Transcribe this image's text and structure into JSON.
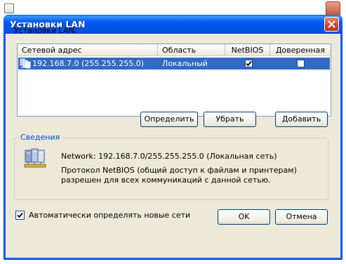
{
  "dialog": {
    "title": "Установки LAN",
    "section_label": "Установки LAN:"
  },
  "list": {
    "columns": [
      "Сетевой адрес",
      "Область",
      "NetBIOS",
      "Доверенная"
    ],
    "rows": [
      {
        "address": "192.168.7.0 (255.255.255.0)",
        "area": "Локальный",
        "netbios": true,
        "trusted": false,
        "selected": true
      }
    ]
  },
  "buttons": {
    "define": "Определить",
    "remove": "Убрать",
    "add": "Добавить",
    "ok": "OK",
    "cancel": "Отмена"
  },
  "details": {
    "legend": "Сведения",
    "network_line": "Network: 192.168.7.0/255.255.255.0 (Локальная сеть)",
    "description": "Протокол NetBIOS (общий доступ к файлам и принтерам) разрешен для всех коммуникаций с данной сетью."
  },
  "autodetect": {
    "label": "Автоматически определять новые сети",
    "checked": true
  },
  "colors": {
    "titlebar": "#0054e3",
    "selection": "#316ac5",
    "dialog_bg": "#ece9d8",
    "groupbox_legend": "#0046d5"
  },
  "icons": {
    "window_close": "close-icon",
    "network": "network-icon"
  }
}
